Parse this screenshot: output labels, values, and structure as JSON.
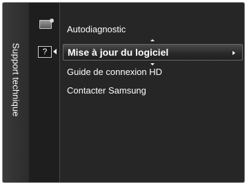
{
  "sidebar": {
    "title": "Support technique"
  },
  "icons": {
    "top": "picture-icon",
    "help": "help-icon",
    "help_glyph": "?"
  },
  "menu": {
    "items": [
      {
        "label": "Autodiagnostic",
        "selected": false
      },
      {
        "label": "Mise à jour du logiciel",
        "selected": true
      },
      {
        "label": "Guide de connexion HD",
        "selected": false
      },
      {
        "label": "Contacter Samsung",
        "selected": false
      }
    ]
  },
  "colors": {
    "background": "#262626",
    "text": "#ffffff",
    "highlight": "#4a4a4a"
  }
}
